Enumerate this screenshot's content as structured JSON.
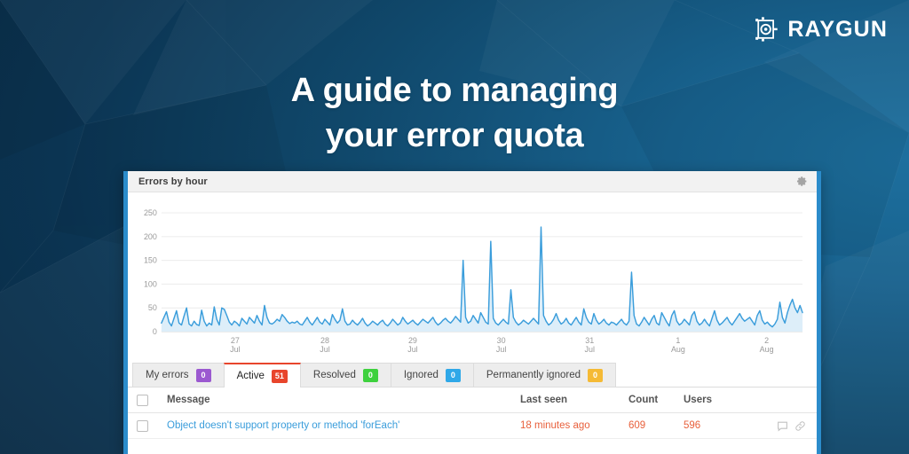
{
  "brand": {
    "name": "RAYGUN",
    "logo_icon": "raygun-logo-icon",
    "accent": "#2b8ccb"
  },
  "headline": {
    "line1": "A guide to managing",
    "line2": "your error quota"
  },
  "widget": {
    "title": "Errors by hour",
    "settings_icon": "gear-icon"
  },
  "tabs": [
    {
      "label": "My errors",
      "count": "0",
      "color": "#9b59d0",
      "active": false
    },
    {
      "label": "Active",
      "count": "51",
      "color": "#e8452c",
      "active": true
    },
    {
      "label": "Resolved",
      "count": "0",
      "color": "#3ed13e",
      "active": false
    },
    {
      "label": "Ignored",
      "count": "0",
      "color": "#2fa8e8",
      "active": false
    },
    {
      "label": "Permanently ignored",
      "count": "0",
      "color": "#f5ba35",
      "active": false
    }
  ],
  "table": {
    "columns": {
      "message": "Message",
      "last_seen": "Last seen",
      "count": "Count",
      "users": "Users"
    },
    "rows": [
      {
        "message": "Object doesn't support property or method 'forEach'",
        "last_seen": "18 minutes ago",
        "count": "609",
        "users": "596",
        "comment_icon": "comment-icon",
        "link_icon": "link-icon"
      }
    ]
  },
  "chart_data": {
    "type": "area",
    "title": "Errors by hour",
    "xlabel": "",
    "ylabel": "",
    "grid": true,
    "legend": false,
    "ylim": [
      0,
      265
    ],
    "yticks": [
      0,
      50,
      100,
      150,
      200,
      250
    ],
    "xticks": [
      "27 Jul",
      "28 Jul",
      "29 Jul",
      "30 Jul",
      "31 Jul",
      "1 Aug",
      "2 Aug"
    ],
    "xtick_positions": [
      0.115,
      0.255,
      0.392,
      0.53,
      0.668,
      0.806,
      0.944
    ],
    "line_color": "#3a9ddb",
    "fill_color": "#ddeef9",
    "series": [
      {
        "name": "Errors",
        "values": [
          18,
          30,
          42,
          20,
          12,
          28,
          44,
          18,
          14,
          33,
          50,
          16,
          12,
          22,
          15,
          13,
          45,
          22,
          12,
          18,
          14,
          52,
          26,
          14,
          50,
          47,
          34,
          20,
          14,
          22,
          18,
          12,
          28,
          22,
          16,
          30,
          24,
          18,
          34,
          22,
          14,
          55,
          30,
          18,
          16,
          20,
          26,
          22,
          36,
          30,
          22,
          17,
          20,
          18,
          22,
          16,
          14,
          22,
          30,
          20,
          14,
          22,
          30,
          20,
          16,
          26,
          20,
          14,
          36,
          26,
          18,
          24,
          48,
          22,
          14,
          16,
          24,
          18,
          14,
          20,
          28,
          18,
          12,
          16,
          22,
          18,
          14,
          20,
          24,
          16,
          12,
          18,
          26,
          20,
          14,
          18,
          30,
          22,
          16,
          20,
          24,
          18,
          14,
          20,
          26,
          22,
          18,
          24,
          30,
          20,
          14,
          18,
          24,
          28,
          22,
          18,
          24,
          32,
          26,
          20,
          150,
          30,
          18,
          22,
          34,
          26,
          18,
          40,
          30,
          20,
          16,
          190,
          28,
          18,
          14,
          20,
          26,
          20,
          16,
          88,
          30,
          20,
          14,
          18,
          24,
          20,
          16,
          22,
          28,
          22,
          16,
          220,
          34,
          22,
          14,
          18,
          26,
          38,
          24,
          16,
          20,
          28,
          18,
          14,
          22,
          30,
          20,
          14,
          48,
          30,
          20,
          16,
          38,
          24,
          16,
          20,
          26,
          18,
          14,
          20,
          18,
          14,
          20,
          26,
          18,
          14,
          22,
          125,
          34,
          16,
          12,
          20,
          30,
          22,
          14,
          26,
          34,
          18,
          14,
          40,
          30,
          20,
          12,
          34,
          44,
          22,
          14,
          18,
          26,
          20,
          14,
          34,
          42,
          22,
          14,
          18,
          26,
          18,
          12,
          28,
          44,
          24,
          14,
          18,
          24,
          30,
          20,
          14,
          22,
          30,
          38,
          28,
          22,
          26,
          30,
          22,
          14,
          34,
          44,
          24,
          16,
          20,
          14,
          10,
          16,
          26,
          62,
          30,
          18,
          40,
          56,
          68,
          50,
          40,
          55,
          40
        ]
      }
    ]
  }
}
